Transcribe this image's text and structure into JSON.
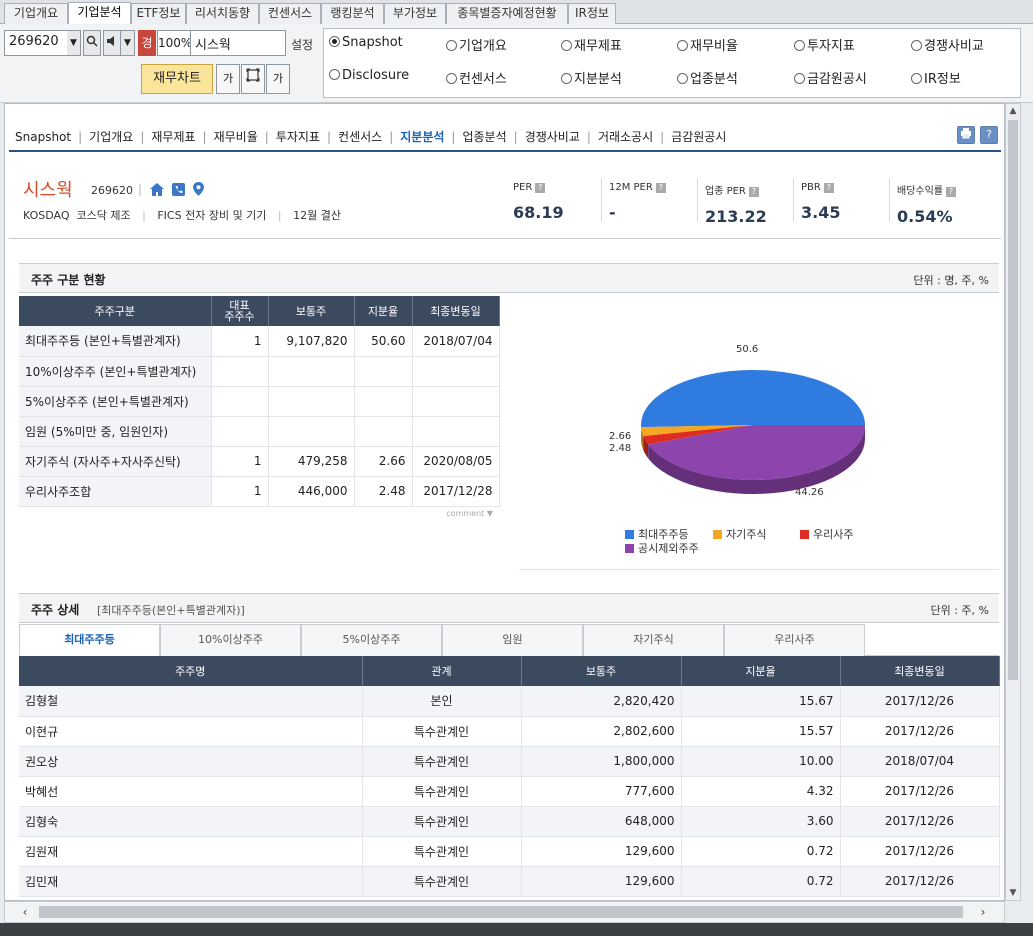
{
  "top_tabs": [
    "기업개요",
    "기업분석",
    "ETF정보",
    "리서치동향",
    "컨센서스",
    "랭킹분석",
    "부가정보",
    "종목별증자예정현황",
    "IR정보"
  ],
  "active_top_tab": 1,
  "controls": {
    "code": "269620",
    "gyeong": "경",
    "zoom": "100%",
    "name": "시스웍",
    "settings_label": "설정",
    "fin_chart_label": "재무차트",
    "tool_ga_up": "가",
    "tool_ga_down": "가"
  },
  "radio_options": [
    {
      "label": "Snapshot",
      "checked": true
    },
    {
      "label": "기업개요",
      "checked": false
    },
    {
      "label": "재무제표",
      "checked": false
    },
    {
      "label": "재무비율",
      "checked": false
    },
    {
      "label": "투자지표",
      "checked": false
    },
    {
      "label": "경쟁사비교",
      "checked": false
    },
    {
      "label": "Disclosure",
      "checked": false
    },
    {
      "label": "컨센서스",
      "checked": false
    },
    {
      "label": "지분분석",
      "checked": false
    },
    {
      "label": "업종분석",
      "checked": false
    },
    {
      "label": "금감원공시",
      "checked": false
    },
    {
      "label": "IR정보",
      "checked": false
    }
  ],
  "subnav": [
    "Snapshot",
    "기업개요",
    "재무제표",
    "재무비율",
    "투자지표",
    "컨센서스",
    "지분분석",
    "업종분석",
    "경쟁사비교",
    "거래소공시",
    "금감원공시"
  ],
  "subnav_active": 6,
  "company": {
    "name": "시스웍",
    "code": "269620",
    "market": "KOSDAQ",
    "market_sector": "코스닥 제조",
    "fics": "FICS 전자 장비 및 기기",
    "settle": "12월 결산"
  },
  "metrics": [
    {
      "label": "PER",
      "value": "68.19"
    },
    {
      "label": "12M PER",
      "value": "-"
    },
    {
      "label": "업종 PER",
      "value": "213.22"
    },
    {
      "label": "PBR",
      "value": "3.45"
    },
    {
      "label": "배당수익률",
      "value": "0.54%"
    }
  ],
  "holders_section": {
    "title": "주주 구분 현황",
    "unit": "단위 : 명, 주, %",
    "headers": [
      "주주구분",
      "대표\n주주수",
      "보통주",
      "지분율",
      "최종변동일"
    ],
    "rows": [
      [
        "최대주주등 (본인+특별관계자)",
        "1",
        "9,107,820",
        "50.60",
        "2018/07/04"
      ],
      [
        "10%이상주주 (본인+특별관계자)",
        "",
        "",
        "",
        ""
      ],
      [
        "5%이상주주 (본인+특별관계자)",
        "",
        "",
        "",
        ""
      ],
      [
        "임원 (5%미만 중, 임원인자)",
        "",
        "",
        "",
        ""
      ],
      [
        "자기주식 (자사주+자사주신탁)",
        "1",
        "479,258",
        "2.66",
        "2020/08/05"
      ],
      [
        "우리사주조합",
        "1",
        "446,000",
        "2.48",
        "2017/12/28"
      ]
    ],
    "comment": "comment"
  },
  "chart_data": {
    "type": "pie",
    "slices": [
      {
        "name": "최대주주등",
        "value": 50.6,
        "color": "#2f7be0"
      },
      {
        "name": "자기주식",
        "value": 2.66,
        "color": "#f5a623"
      },
      {
        "name": "우리사주",
        "value": 2.48,
        "color": "#e02b20"
      },
      {
        "name": "공시제외주주",
        "value": 44.26,
        "color": "#8e44ad"
      }
    ],
    "labels": [
      "50.6",
      "2.66",
      "2.48",
      "44.26"
    ]
  },
  "detail_section": {
    "title": "주주 상세",
    "sub": "[최대주주등(본인+특별관계자)]",
    "unit": "단위 : 주, %",
    "tabs": [
      "최대주주등",
      "10%이상주주",
      "5%이상주주",
      "임원",
      "자기주식",
      "우리사주"
    ],
    "active_tab": 0,
    "headers": [
      "주주명",
      "관계",
      "보통주",
      "지분율",
      "최종변동일"
    ],
    "rows": [
      [
        "김형철",
        "본인",
        "2,820,420",
        "15.67",
        "2017/12/26"
      ],
      [
        "이현규",
        "특수관계인",
        "2,802,600",
        "15.57",
        "2017/12/26"
      ],
      [
        "권오상",
        "특수관계인",
        "1,800,000",
        "10.00",
        "2018/07/04"
      ],
      [
        "박혜선",
        "특수관계인",
        "777,600",
        "4.32",
        "2017/12/26"
      ],
      [
        "김형숙",
        "특수관계인",
        "648,000",
        "3.60",
        "2017/12/26"
      ],
      [
        "김원재",
        "특수관계인",
        "129,600",
        "0.72",
        "2017/12/26"
      ],
      [
        "김민재",
        "특수관계인",
        "129,600",
        "0.72",
        "2017/12/26"
      ]
    ]
  }
}
